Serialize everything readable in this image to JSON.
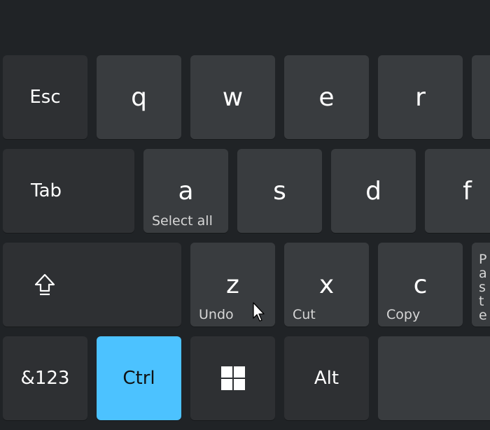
{
  "keyboard": {
    "row1": [
      {
        "label": "Esc"
      },
      {
        "label": "q"
      },
      {
        "label": "w"
      },
      {
        "label": "e"
      },
      {
        "label": "r"
      }
    ],
    "row2": [
      {
        "label": "Tab"
      },
      {
        "label": "a",
        "sub": "Select all"
      },
      {
        "label": "s"
      },
      {
        "label": "d"
      },
      {
        "label": "f"
      }
    ],
    "row3": [
      {
        "icon": "shift-icon"
      },
      {
        "label": "z",
        "sub": "Undo"
      },
      {
        "label": "x",
        "sub": "Cut"
      },
      {
        "label": "c",
        "sub": "Copy"
      },
      {
        "sub": "Paste"
      }
    ],
    "row4": [
      {
        "label": "&123"
      },
      {
        "label": "Ctrl",
        "active": true
      },
      {
        "icon": "windows-logo-icon"
      },
      {
        "label": "Alt"
      },
      {
        "label": ""
      }
    ]
  },
  "colors": {
    "background": "#202326",
    "key": "#393c3f",
    "function_key": "#2e3033",
    "accent": "#4cc2ff"
  }
}
